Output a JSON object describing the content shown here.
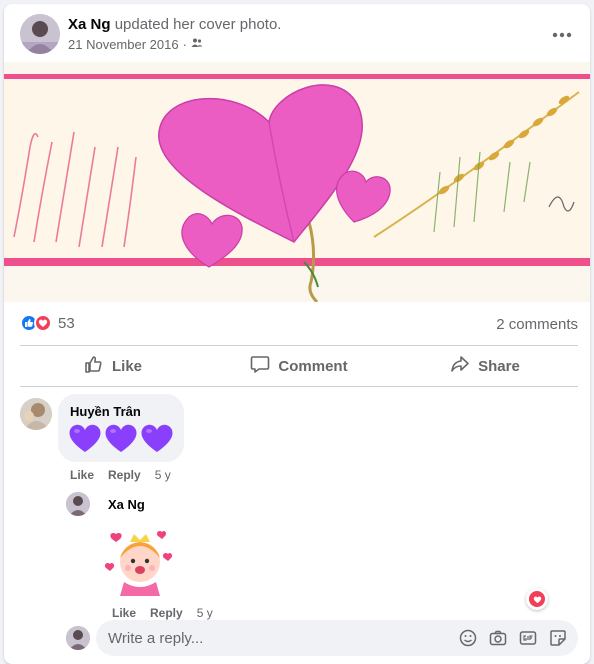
{
  "post": {
    "author": "Xa Ng",
    "action": "updated her cover photo.",
    "date": "21 November 2016",
    "audience_icon": "friends-icon",
    "more_icon": "more-horizontal-icon"
  },
  "stats": {
    "reactions_count": "53",
    "comments_count": "2 comments",
    "reaction_icons": [
      "like-icon",
      "love-icon"
    ]
  },
  "actions": {
    "like": "Like",
    "comment": "Comment",
    "share": "Share"
  },
  "comments": [
    {
      "author": "Huyền Trân",
      "content": "💜💜💜",
      "like": "Like",
      "reply": "Reply",
      "time": "5 y"
    }
  ],
  "reply": {
    "author": "Xa Ng",
    "sticker": "sticker-princess-hearts",
    "like": "Like",
    "reply": "Reply",
    "time": "5 y"
  },
  "reply_box": {
    "placeholder": "Write a reply...",
    "icons": [
      "emoji-icon",
      "camera-icon",
      "gif-icon",
      "sticker-icon"
    ]
  },
  "colors": {
    "accent_blue": "#1877f2",
    "love_red": "#f33e58",
    "purple_heart": "#8a3ffc"
  }
}
